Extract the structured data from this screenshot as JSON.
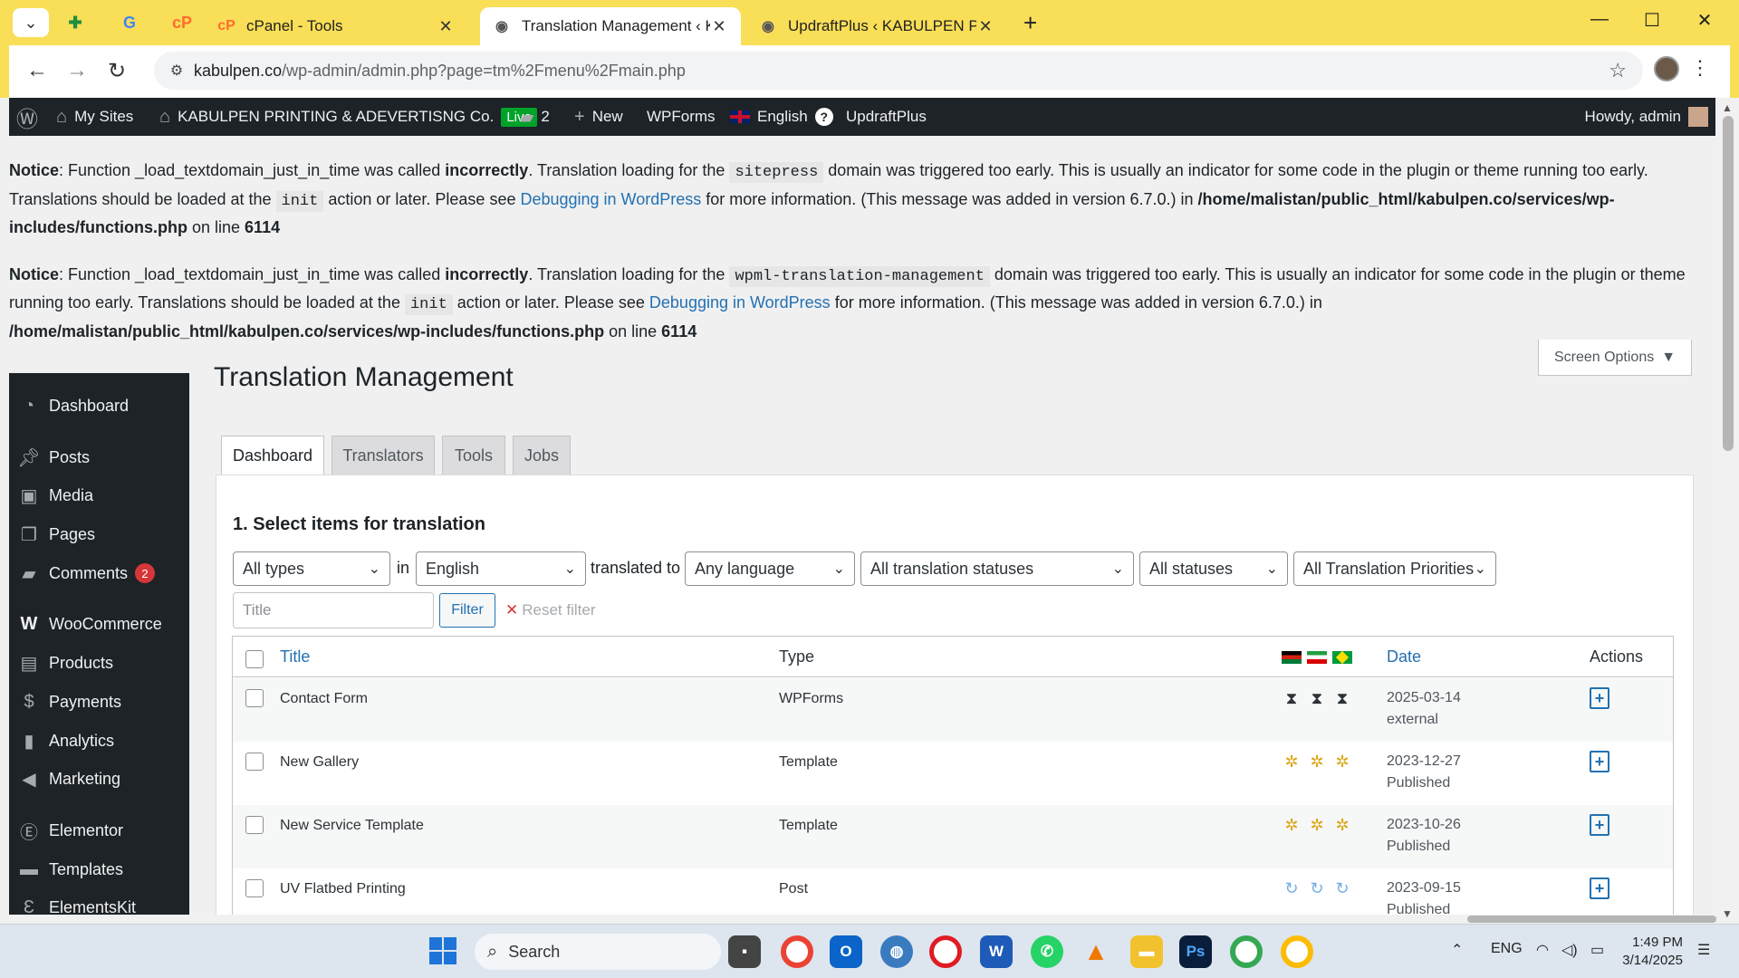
{
  "browser": {
    "tabs": [
      {
        "title": "cPanel - Tools"
      },
      {
        "title": "Translation Management ‹ KABU"
      },
      {
        "title": "UpdraftPlus ‹ KABULPEN PRINT"
      }
    ],
    "url_domain": "kabulpen.co",
    "url_path": "/wp-admin/admin.php?page=tm%2Fmenu%2Fmain.php"
  },
  "adminbar": {
    "my_sites": "My Sites",
    "site_name": "KABULPEN PRINTING & ADEVERTISNG Co.",
    "live": "Live",
    "comments_count": "2",
    "new": "New",
    "wpforms": "WPForms",
    "language": "English",
    "help": "?",
    "updraft": "UpdraftPlus",
    "howdy": "Howdy, admin"
  },
  "notices": [
    {
      "label": "Notice",
      "t1": ": Function _load_textdomain_just_in_time was called ",
      "bold1": "incorrectly",
      "t2": ". Translation loading for the ",
      "code1": "sitepress",
      "t3": " domain was triggered too early. This is usually an indicator for some code in the plugin or theme running too early. Translations should be loaded at the ",
      "code2": "init",
      "t4": " action or later. Please see ",
      "link": "Debugging in WordPress",
      "t5": " for more information. (This message was added in version 6.7.0.) in ",
      "path": "/home/malistan/public_html/kabulpen.co/services/wp-includes/functions.php",
      "t6": " on line ",
      "line": "6114"
    },
    {
      "label": "Notice",
      "t1": ": Function _load_textdomain_just_in_time was called ",
      "bold1": "incorrectly",
      "t2": ". Translation loading for the ",
      "code1": "wpml-translation-management",
      "t3": " domain was triggered too early. This is usually an indicator for some code in the plugin or theme running too early. Translations should be loaded at the ",
      "code2": "init",
      "t4": " action or later. Please see ",
      "link": "Debugging in WordPress",
      "t5": " for more information. (This message was added in version 6.7.0.) in ",
      "path": "/home/malistan/public_html/kabulpen.co/services/wp-includes/functions.php",
      "t6": " on line ",
      "line": "6114"
    }
  ],
  "menu": {
    "items": [
      {
        "label": "Dashboard",
        "icon": "dashboard-icon"
      },
      {
        "label": "Posts",
        "icon": "pin-icon"
      },
      {
        "label": "Media",
        "icon": "media-icon"
      },
      {
        "label": "Pages",
        "icon": "pages-icon"
      },
      {
        "label": "Comments",
        "icon": "comment-icon",
        "badge": "2"
      },
      {
        "label": "WooCommerce",
        "icon": "woocommerce-icon"
      },
      {
        "label": "Products",
        "icon": "archive-icon"
      },
      {
        "label": "Payments",
        "icon": "payments-icon"
      },
      {
        "label": "Analytics",
        "icon": "chart-bar-icon"
      },
      {
        "label": "Marketing",
        "icon": "megaphone-icon"
      },
      {
        "label": "Elementor",
        "icon": "elementor-icon"
      },
      {
        "label": "Templates",
        "icon": "folder-icon"
      },
      {
        "label": "ElementsKit",
        "icon": "elementskit-icon"
      }
    ]
  },
  "screen_options": "Screen Options",
  "page_title": "Translation Management",
  "tabs": [
    "Dashboard",
    "Translators",
    "Tools",
    "Jobs"
  ],
  "section_title": "1. Select items for translation",
  "filters": {
    "type": "All types",
    "in": "in",
    "source_lang": "English",
    "translated_to": "translated to",
    "target_lang": "Any language",
    "translation_status": "All translation statuses",
    "status": "All statuses",
    "priority": "All Translation Priorities",
    "title_placeholder": "Title",
    "filter_btn": "Filter",
    "reset": "Reset filter"
  },
  "table": {
    "headers": {
      "title": "Title",
      "type": "Type",
      "date": "Date",
      "actions": "Actions"
    },
    "rows": [
      {
        "title": "Contact Form",
        "type": "WPForms",
        "date": "2025-03-14",
        "status": "external",
        "icon": "hourglass-icon"
      },
      {
        "title": "New Gallery",
        "type": "Template",
        "date": "2023-12-27",
        "status": "Published",
        "icon": "needs-translation-icon"
      },
      {
        "title": "New Service Template",
        "type": "Template",
        "date": "2023-10-26",
        "status": "Published",
        "icon": "needs-translation-icon"
      },
      {
        "title": "UV Flatbed Printing",
        "type": "Post",
        "date": "2023-09-15",
        "status": "Published",
        "icon": "sync-icon"
      }
    ]
  },
  "taskbar": {
    "search": "Search",
    "lang": "ENG",
    "time": "1:49 PM",
    "date": "3/14/2025"
  }
}
